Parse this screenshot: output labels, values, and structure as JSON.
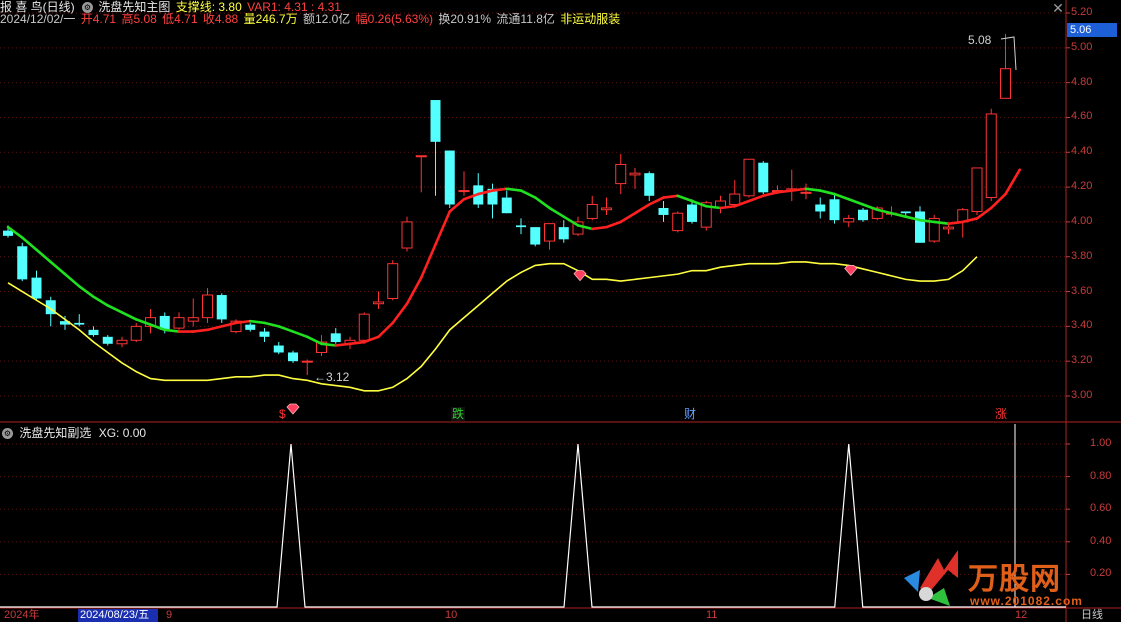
{
  "header": {
    "stock_name": "报 喜 鸟(日线)",
    "indicator_name": "洗盘先知主图",
    "support_label": "支撑线: 3.80",
    "var1_label": "VAR1: 4.31 : 4.31",
    "close_icon": "close-x-icon"
  },
  "info_bar": {
    "date": "2024/12/02/一",
    "open": "开4.71",
    "high": "高5.08",
    "low": "低4.71",
    "close": "收4.88",
    "volume": "量246.7万",
    "amount": "额12.0亿",
    "amplitude": "幅0.26(5.63%)",
    "turnover": "换20.91%",
    "float_cap": "流通11.8亿",
    "sector": "非运动服装"
  },
  "price_axis": [
    "5.20",
    "5.00",
    "4.80",
    "4.60",
    "4.40",
    "4.20",
    "4.00",
    "3.80",
    "3.60",
    "3.40",
    "3.20",
    "3.00"
  ],
  "current_price": "5.06",
  "annotations": {
    "high_marker": "5.08",
    "low_marker": "3.12"
  },
  "signals": [
    {
      "label": "$",
      "color": "#ff3030"
    },
    {
      "label": "跌",
      "color": "#30d030"
    },
    {
      "label": "财",
      "color": "#60a0ff"
    },
    {
      "label": "涨",
      "color": "#ff3030"
    }
  ],
  "sub_panel": {
    "title": "洗盘先知副选",
    "xg_label": "XG: 0.00",
    "axis": [
      "1.00",
      "0.80",
      "0.60",
      "0.40",
      "0.20"
    ]
  },
  "date_axis": {
    "year": "2024年",
    "cursor_date": "2024/08/23/五",
    "months": [
      "9",
      "10",
      "11",
      "12"
    ],
    "period": "日线"
  },
  "watermark": {
    "brand": "万股网",
    "url": "www.201082.com"
  },
  "colors": {
    "up": "#ff3333",
    "down": "#54ffff",
    "ma_up": "#ff2020",
    "ma_down": "#20e020",
    "support": "#ffff40",
    "axis": "#c83c3c"
  },
  "chart_data": {
    "type": "candlestick",
    "ylim": [
      2.9,
      5.25
    ],
    "candles": [
      {
        "o": 3.95,
        "h": 3.98,
        "l": 3.91,
        "c": 3.92
      },
      {
        "o": 3.86,
        "h": 3.88,
        "l": 3.66,
        "c": 3.67
      },
      {
        "o": 3.68,
        "h": 3.72,
        "l": 3.55,
        "c": 3.56
      },
      {
        "o": 3.55,
        "h": 3.57,
        "l": 3.4,
        "c": 3.47
      },
      {
        "o": 3.43,
        "h": 3.46,
        "l": 3.38,
        "c": 3.41
      },
      {
        "o": 3.42,
        "h": 3.47,
        "l": 3.4,
        "c": 3.41
      },
      {
        "o": 3.38,
        "h": 3.4,
        "l": 3.34,
        "c": 3.35
      },
      {
        "o": 3.34,
        "h": 3.35,
        "l": 3.29,
        "c": 3.3
      },
      {
        "o": 3.3,
        "h": 3.34,
        "l": 3.28,
        "c": 3.32
      },
      {
        "o": 3.32,
        "h": 3.42,
        "l": 3.31,
        "c": 3.4
      },
      {
        "o": 3.4,
        "h": 3.5,
        "l": 3.36,
        "c": 3.45
      },
      {
        "o": 3.46,
        "h": 3.48,
        "l": 3.36,
        "c": 3.38
      },
      {
        "o": 3.39,
        "h": 3.48,
        "l": 3.38,
        "c": 3.45
      },
      {
        "o": 3.43,
        "h": 3.56,
        "l": 3.4,
        "c": 3.45
      },
      {
        "o": 3.45,
        "h": 3.62,
        "l": 3.42,
        "c": 3.58
      },
      {
        "o": 3.58,
        "h": 3.59,
        "l": 3.42,
        "c": 3.44
      },
      {
        "o": 3.37,
        "h": 3.44,
        "l": 3.36,
        "c": 3.43
      },
      {
        "o": 3.41,
        "h": 3.42,
        "l": 3.37,
        "c": 3.38
      },
      {
        "o": 3.37,
        "h": 3.39,
        "l": 3.31,
        "c": 3.34
      },
      {
        "o": 3.29,
        "h": 3.31,
        "l": 3.24,
        "c": 3.25
      },
      {
        "o": 3.25,
        "h": 3.26,
        "l": 3.19,
        "c": 3.2
      },
      {
        "o": 3.2,
        "h": 3.21,
        "l": 3.12,
        "c": 3.2
      },
      {
        "o": 3.25,
        "h": 3.35,
        "l": 3.23,
        "c": 3.31
      },
      {
        "o": 3.36,
        "h": 3.39,
        "l": 3.3,
        "c": 3.31
      },
      {
        "o": 3.3,
        "h": 3.34,
        "l": 3.27,
        "c": 3.32
      },
      {
        "o": 3.32,
        "h": 3.48,
        "l": 3.3,
        "c": 3.47
      },
      {
        "o": 3.53,
        "h": 3.6,
        "l": 3.5,
        "c": 3.54
      },
      {
        "o": 3.56,
        "h": 3.78,
        "l": 3.55,
        "c": 3.76
      },
      {
        "o": 3.85,
        "h": 4.03,
        "l": 3.83,
        "c": 4.0
      },
      {
        "o": 4.38,
        "h": 4.38,
        "l": 4.17,
        "c": 4.38
      },
      {
        "o": 4.7,
        "h": 4.7,
        "l": 4.15,
        "c": 4.46
      },
      {
        "o": 4.41,
        "h": 4.41,
        "l": 4.08,
        "c": 4.1
      },
      {
        "o": 4.18,
        "h": 4.29,
        "l": 4.15,
        "c": 4.18
      },
      {
        "o": 4.21,
        "h": 4.28,
        "l": 4.08,
        "c": 4.1
      },
      {
        "o": 4.19,
        "h": 4.22,
        "l": 4.02,
        "c": 4.1
      },
      {
        "o": 4.14,
        "h": 4.18,
        "l": 4.05,
        "c": 4.05
      },
      {
        "o": 3.98,
        "h": 4.02,
        "l": 3.93,
        "c": 3.97
      },
      {
        "o": 3.97,
        "h": 3.97,
        "l": 3.86,
        "c": 3.87
      },
      {
        "o": 3.89,
        "h": 3.99,
        "l": 3.84,
        "c": 3.99
      },
      {
        "o": 3.97,
        "h": 4.01,
        "l": 3.88,
        "c": 3.9
      },
      {
        "o": 3.93,
        "h": 4.03,
        "l": 3.92,
        "c": 4.0
      },
      {
        "o": 4.02,
        "h": 4.15,
        "l": 4.01,
        "c": 4.1
      },
      {
        "o": 4.07,
        "h": 4.14,
        "l": 4.04,
        "c": 4.08
      },
      {
        "o": 4.22,
        "h": 4.39,
        "l": 4.16,
        "c": 4.33
      },
      {
        "o": 4.27,
        "h": 4.31,
        "l": 4.19,
        "c": 4.28
      },
      {
        "o": 4.28,
        "h": 4.29,
        "l": 4.12,
        "c": 4.15
      },
      {
        "o": 4.08,
        "h": 4.12,
        "l": 4.0,
        "c": 4.04
      },
      {
        "o": 3.95,
        "h": 4.06,
        "l": 3.94,
        "c": 4.05
      },
      {
        "o": 4.1,
        "h": 4.13,
        "l": 3.99,
        "c": 4.0
      },
      {
        "o": 3.97,
        "h": 4.12,
        "l": 3.95,
        "c": 4.11
      },
      {
        "o": 4.08,
        "h": 4.15,
        "l": 4.05,
        "c": 4.12
      },
      {
        "o": 4.1,
        "h": 4.24,
        "l": 4.09,
        "c": 4.16
      },
      {
        "o": 4.15,
        "h": 4.36,
        "l": 4.14,
        "c": 4.36
      },
      {
        "o": 4.34,
        "h": 4.35,
        "l": 4.16,
        "c": 4.17
      },
      {
        "o": 4.18,
        "h": 4.21,
        "l": 4.16,
        "c": 4.18
      },
      {
        "o": 4.18,
        "h": 4.3,
        "l": 4.12,
        "c": 4.19
      },
      {
        "o": 4.17,
        "h": 4.22,
        "l": 4.13,
        "c": 4.17
      },
      {
        "o": 4.1,
        "h": 4.14,
        "l": 4.02,
        "c": 4.06
      },
      {
        "o": 4.13,
        "h": 4.16,
        "l": 3.99,
        "c": 4.01
      },
      {
        "o": 4.0,
        "h": 4.04,
        "l": 3.97,
        "c": 4.02
      },
      {
        "o": 4.07,
        "h": 4.08,
        "l": 4.0,
        "c": 4.01
      },
      {
        "o": 4.02,
        "h": 4.09,
        "l": 4.01,
        "c": 4.08
      },
      {
        "o": 4.05,
        "h": 4.09,
        "l": 4.03,
        "c": 4.05
      },
      {
        "o": 4.06,
        "h": 4.06,
        "l": 4.03,
        "c": 4.05
      },
      {
        "o": 4.06,
        "h": 4.09,
        "l": 3.88,
        "c": 3.88
      },
      {
        "o": 3.89,
        "h": 4.04,
        "l": 3.88,
        "c": 4.02
      },
      {
        "o": 3.96,
        "h": 3.99,
        "l": 3.93,
        "c": 3.97
      },
      {
        "o": 4.0,
        "h": 4.08,
        "l": 3.91,
        "c": 4.07
      },
      {
        "o": 4.06,
        "h": 4.31,
        "l": 4.04,
        "c": 4.31
      },
      {
        "o": 4.14,
        "h": 4.65,
        "l": 4.12,
        "c": 4.62
      },
      {
        "o": 4.71,
        "h": 5.08,
        "l": 4.71,
        "c": 4.88
      }
    ],
    "ma_line": [
      3.97,
      3.91,
      3.84,
      3.77,
      3.7,
      3.63,
      3.57,
      3.52,
      3.48,
      3.44,
      3.41,
      3.38,
      3.37,
      3.37,
      3.38,
      3.4,
      3.42,
      3.43,
      3.42,
      3.4,
      3.37,
      3.34,
      3.3,
      3.29,
      3.3,
      3.31,
      3.34,
      3.42,
      3.53,
      3.68,
      3.87,
      4.06,
      4.13,
      4.16,
      4.18,
      4.19,
      4.18,
      4.14,
      4.08,
      4.03,
      3.98,
      3.96,
      3.97,
      4.0,
      4.05,
      4.1,
      4.14,
      4.15,
      4.12,
      4.09,
      4.08,
      4.09,
      4.12,
      4.15,
      4.17,
      4.18,
      4.19,
      4.18,
      4.16,
      4.13,
      4.1,
      4.07,
      4.05,
      4.03,
      4.01,
      4.0,
      3.99,
      4.0,
      4.02,
      4.08,
      4.16,
      4.3
    ],
    "support_line": [
      3.65,
      3.6,
      3.55,
      3.5,
      3.44,
      3.38,
      3.31,
      3.25,
      3.19,
      3.14,
      3.1,
      3.09,
      3.09,
      3.09,
      3.09,
      3.1,
      3.11,
      3.11,
      3.12,
      3.12,
      3.1,
      3.09,
      3.07,
      3.06,
      3.05,
      3.03,
      3.03,
      3.05,
      3.1,
      3.17,
      3.27,
      3.38,
      3.45,
      3.52,
      3.59,
      3.66,
      3.71,
      3.75,
      3.76,
      3.76,
      3.72,
      3.67,
      3.67,
      3.66,
      3.67,
      3.68,
      3.69,
      3.7,
      3.72,
      3.72,
      3.74,
      3.75,
      3.76,
      3.76,
      3.76,
      3.77,
      3.77,
      3.76,
      3.76,
      3.75,
      3.73,
      3.71,
      3.69,
      3.67,
      3.66,
      3.66,
      3.67,
      3.72,
      3.8
    ],
    "ma_up_flags": [
      0,
      0,
      0,
      0,
      0,
      0,
      0,
      0,
      0,
      0,
      0,
      0,
      1,
      1,
      1,
      1,
      1,
      0,
      0,
      0,
      0,
      0,
      0,
      1,
      1,
      1,
      1,
      1,
      1,
      1,
      1,
      1,
      1,
      1,
      1,
      0,
      0,
      0,
      0,
      0,
      0,
      1,
      1,
      1,
      1,
      1,
      1,
      0,
      0,
      0,
      1,
      1,
      1,
      1,
      1,
      1,
      0,
      0,
      0,
      0,
      0,
      0,
      0,
      0,
      0,
      0,
      1,
      1,
      1,
      1,
      1,
      1
    ],
    "diamonds": [
      20,
      40,
      59
    ],
    "xg_peaks": [
      20,
      40,
      59
    ]
  }
}
